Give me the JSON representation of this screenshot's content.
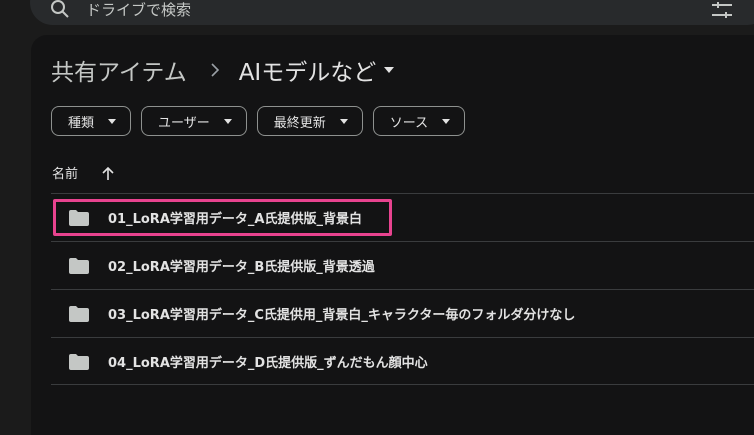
{
  "search": {
    "placeholder": "ドライブで検索"
  },
  "breadcrumb": {
    "root": "共有アイテム",
    "current": "AIモデルなど"
  },
  "filters": [
    {
      "label": "種類"
    },
    {
      "label": "ユーザー"
    },
    {
      "label": "最終更新"
    },
    {
      "label": "ソース"
    }
  ],
  "columns": {
    "name": "名前"
  },
  "files": [
    {
      "name": "01_LoRA学習用データ_A氏提供版_背景白"
    },
    {
      "name": "02_LoRA学習用データ_B氏提供版_背景透過"
    },
    {
      "name": "03_LoRA学習用データ_C氏提供用_背景白_キャラクター毎のフォルダ分けなし"
    },
    {
      "name": "04_LoRA学習用データ_D氏提供版_ずんだもん顔中心"
    }
  ],
  "colors": {
    "highlight": "#e8438f",
    "background": "#131314"
  }
}
